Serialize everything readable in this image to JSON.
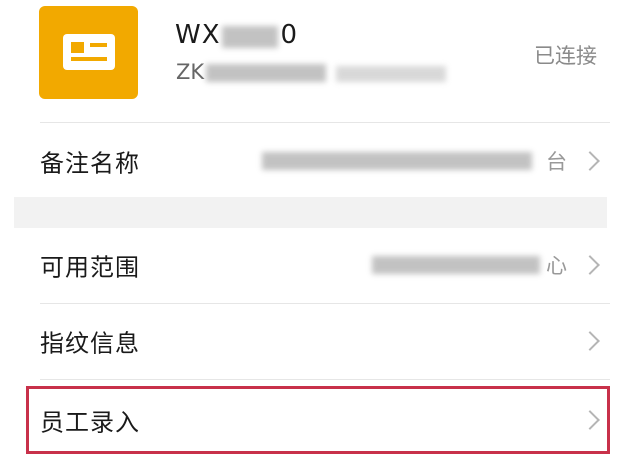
{
  "device": {
    "name": "WX",
    "name_tail": "0",
    "subtitle": "ZK",
    "status": "已连接"
  },
  "rows": [
    {
      "label": "备注名称",
      "value_tail": "台"
    },
    {
      "label": "可用范围",
      "value_tail": "心"
    },
    {
      "label": "指纹信息"
    },
    {
      "label": "员工录入"
    }
  ],
  "colors": {
    "icon_bg": "#F2A900",
    "highlight_border": "#C8314A"
  },
  "icons": {
    "device": "id-card-icon",
    "chevron": "chevron-right-icon"
  }
}
